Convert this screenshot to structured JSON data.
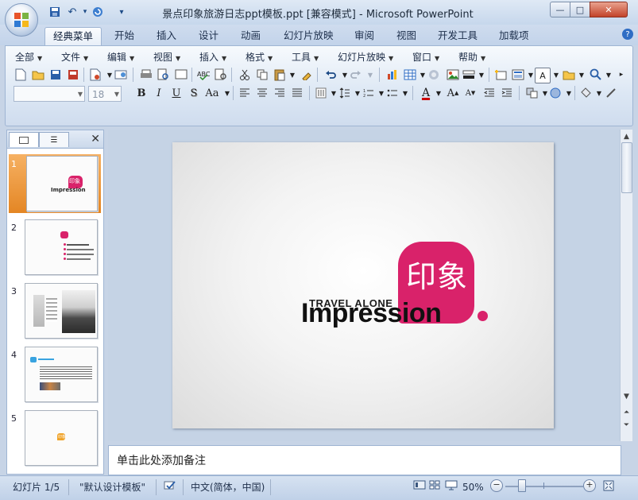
{
  "window": {
    "title": "景点印象旅游日志ppt模板.ppt [兼容模式] - Microsoft PowerPoint",
    "controls": {
      "minimize": "—",
      "maximize": "□",
      "close": "✕"
    }
  },
  "quick_access": {
    "dropdown": "▾"
  },
  "ribbon_tabs": [
    "经典菜单",
    "开始",
    "插入",
    "设计",
    "动画",
    "幻灯片放映",
    "审阅",
    "视图",
    "开发工具",
    "加载项"
  ],
  "help": "?",
  "classic_menus": [
    "全部",
    "文件",
    "编辑",
    "视图",
    "插入",
    "格式",
    "工具",
    "幻灯片放映",
    "窗口",
    "帮助"
  ],
  "font": {
    "name": "",
    "size": "18"
  },
  "format_buttons": {
    "bold": "B",
    "italic": "I",
    "underline": "U",
    "shadow": "S",
    "case": "Aa"
  },
  "font_color_letter": "A",
  "pane": {
    "close": "✕"
  },
  "slides": [
    {
      "number": "1"
    },
    {
      "number": "2"
    },
    {
      "number": "3"
    },
    {
      "number": "4"
    },
    {
      "number": "5"
    }
  ],
  "current_slide": {
    "chinese_title": "印象",
    "subtitle": "TRAVEL ALONE",
    "title": "Impression",
    "accent_color": "#d9226a"
  },
  "thumbnails": {
    "slide1_cn": "印象",
    "slide1_title": "Impression",
    "slide5_cn": "印象"
  },
  "notes": {
    "placeholder": "单击此处添加备注"
  },
  "status": {
    "slide_indicator": "幻灯片 1/5",
    "theme": "\"默认设计模板\"",
    "language": "中文(简体，中国)",
    "zoom": "50%",
    "zoom_out": "−",
    "zoom_in": "+"
  }
}
